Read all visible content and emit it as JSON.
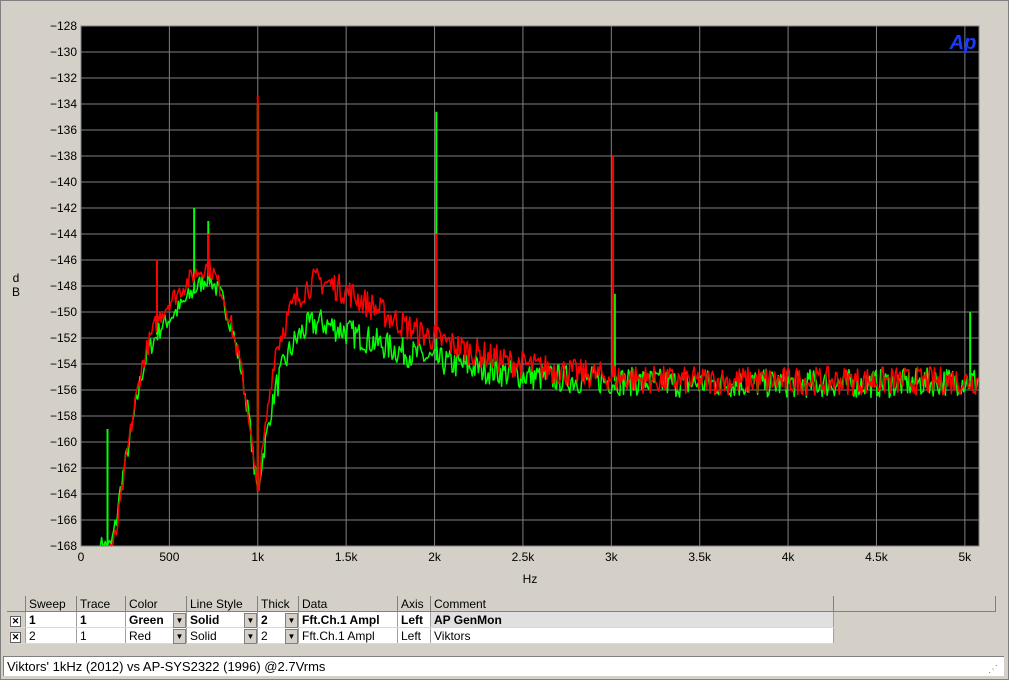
{
  "chart_data": {
    "type": "line",
    "xlabel": "Hz",
    "ylabel": "dB",
    "xlim": [
      0,
      5080
    ],
    "ylim": [
      -168,
      -128
    ],
    "x_ticks": [
      0,
      500,
      1000,
      1500,
      2000,
      2500,
      3000,
      3500,
      4000,
      4500,
      5000
    ],
    "x_tick_labels": [
      "0",
      "500",
      "1k",
      "1.5k",
      "2k",
      "2.5k",
      "3k",
      "3.5k",
      "4k",
      "4.5k",
      "5k"
    ],
    "y_ticks": [
      -128,
      -130,
      -132,
      -134,
      -136,
      -138,
      -140,
      -142,
      -144,
      -146,
      -148,
      -150,
      -152,
      -154,
      -156,
      -158,
      -160,
      -162,
      -164,
      -166,
      -168
    ],
    "grid": true,
    "background": "#000000",
    "grid_color": "#808080",
    "logo": "Ap",
    "series": [
      {
        "color": "#00ff00",
        "x": [
          110,
          130,
          150,
          170,
          200,
          230,
          260,
          300,
          340,
          380,
          420,
          460,
          500,
          550,
          600,
          650,
          700,
          720,
          750,
          800,
          850,
          900,
          950,
          980,
          1000,
          1030,
          1070,
          1100,
          1150,
          1200,
          1250,
          1300,
          1350,
          1400,
          1500,
          1600,
          1700,
          1800,
          1900,
          2000,
          2100,
          2200,
          2400,
          2600,
          2800,
          3000,
          3200,
          3400,
          3600,
          3800,
          4000,
          4200,
          4400,
          4600,
          4800,
          5000,
          5080
        ],
        "y": [
          -168,
          -168,
          -168,
          -168,
          -166,
          -163,
          -161,
          -158,
          -155,
          -153,
          -152,
          -151,
          -150.5,
          -149.8,
          -149,
          -148.2,
          -147.5,
          -147.3,
          -147.8,
          -149,
          -151,
          -154,
          -158,
          -162,
          -163.8,
          -161,
          -158,
          -156,
          -154,
          -152.5,
          -151.5,
          -151,
          -150.8,
          -151,
          -151.5,
          -152,
          -152.5,
          -153,
          -153.3,
          -153.7,
          -154,
          -154.2,
          -154.7,
          -155,
          -155.2,
          -155.3,
          -155.4,
          -155.5,
          -155.5,
          -155.5,
          -155.5,
          -155.5,
          -155.5,
          -155.5,
          -155.4,
          -155.3,
          -155.3
        ],
        "spikes": [
          {
            "x": 150,
            "y": -159
          },
          {
            "x": 430,
            "y": -147
          },
          {
            "x": 640,
            "y": -142
          },
          {
            "x": 720,
            "y": -143
          },
          {
            "x": 1000,
            "y": -134
          },
          {
            "x": 2010,
            "y": -134.6
          },
          {
            "x": 3020,
            "y": -148.6
          },
          {
            "x": 5030,
            "y": -150
          }
        ]
      },
      {
        "color": "#ff0000",
        "x": [
          160,
          180,
          200,
          230,
          260,
          300,
          340,
          380,
          420,
          460,
          500,
          550,
          600,
          650,
          700,
          720,
          750,
          800,
          850,
          900,
          950,
          980,
          1000,
          1030,
          1070,
          1100,
          1150,
          1200,
          1250,
          1300,
          1350,
          1400,
          1500,
          1600,
          1700,
          1800,
          1900,
          2000,
          2100,
          2200,
          2400,
          2600,
          2800,
          3000,
          3200,
          3400,
          3600,
          3800,
          4000,
          4200,
          4400,
          4600,
          4800,
          5000,
          5080
        ],
        "y": [
          -168,
          -168,
          -167,
          -164,
          -161,
          -157.5,
          -154.5,
          -152.5,
          -151,
          -150,
          -149.2,
          -148.5,
          -147.7,
          -147,
          -146.6,
          -146.5,
          -147,
          -148.5,
          -151,
          -154,
          -158,
          -162,
          -163.8,
          -160.5,
          -156,
          -153,
          -151,
          -149.5,
          -148.4,
          -147.8,
          -147.6,
          -147.8,
          -148.4,
          -149.2,
          -150,
          -150.8,
          -151.5,
          -152,
          -152.5,
          -153,
          -153.8,
          -154.3,
          -154.7,
          -155,
          -155.2,
          -155.3,
          -155.3,
          -155.3,
          -155.3,
          -155.3,
          -155.3,
          -155.3,
          -155.3,
          -155.3,
          -155.3
        ],
        "spikes": [
          {
            "x": 430,
            "y": -146
          },
          {
            "x": 720,
            "y": -144
          },
          {
            "x": 1000,
            "y": -133.4
          },
          {
            "x": 2010,
            "y": -144
          },
          {
            "x": 3010,
            "y": -138
          }
        ]
      }
    ]
  },
  "legend": {
    "headers": [
      "Sweep",
      "Trace",
      "Color",
      "Line Style",
      "Thick",
      "Data",
      "Axis",
      "Comment"
    ],
    "rows": [
      {
        "sweep": "1",
        "trace": "1",
        "color": "Green",
        "style": "Solid",
        "thick": "2",
        "data": "Fft.Ch.1 Ampl",
        "axis": "Left",
        "comment": "AP GenMon"
      },
      {
        "sweep": "2",
        "trace": "1",
        "color": "Red",
        "style": "Solid",
        "thick": "2",
        "data": "Fft.Ch.1 Ampl",
        "axis": "Left",
        "comment": "Viktors"
      }
    ]
  },
  "status": {
    "text": "Viktors' 1kHz (2012) vs AP-SYS2322 (1996) @2.7Vrms"
  }
}
